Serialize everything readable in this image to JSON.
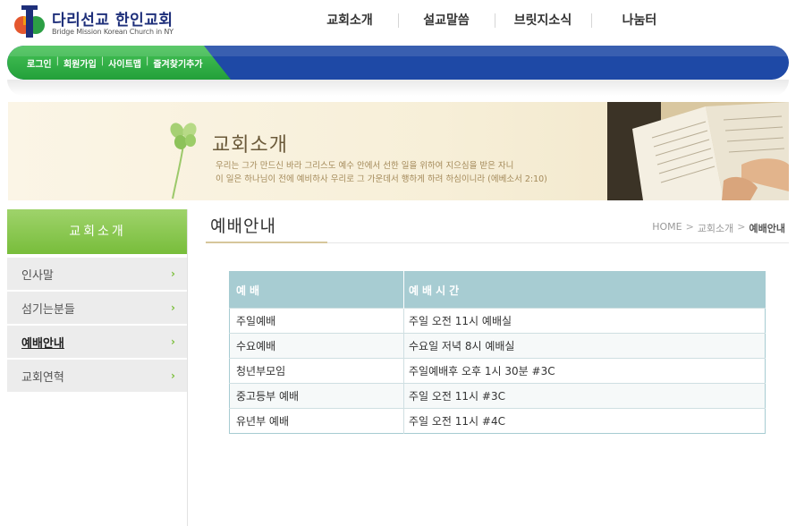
{
  "header": {
    "logo_title": "다리선교 한인교회",
    "logo_subtitle": "Bridge Mission Korean Church in NY",
    "nav": [
      "교회소개",
      "설교말씀",
      "브릿지소식",
      "나눔터"
    ]
  },
  "util_links": [
    "로그인",
    "회원가입",
    "사이트맵",
    "즐겨찾기추가"
  ],
  "banner": {
    "title": "교회소개",
    "verse_line1": "우리는 그가 만드신 바라 그리스도 예수 안에서 선한 일을 위하여 지으심을 받은 자니",
    "verse_line2": "이 일은 하나님이 전에 예비하사 우리로 그 가운데서 행하게 하려 하심이니라 (에베소서 2:10)"
  },
  "sidebar": {
    "title": "교회소개",
    "items": [
      {
        "label": "인사말",
        "arrow": "›"
      },
      {
        "label": "섬기는분들",
        "arrow": "›"
      },
      {
        "label": "예배안내",
        "arrow": "›"
      },
      {
        "label": "교회연혁",
        "arrow": "›"
      }
    ],
    "active_index": 2
  },
  "content": {
    "title": "예배안내",
    "breadcrumb": [
      "HOME",
      "교회소개",
      "예배안내"
    ],
    "breadcrumb_sep": ">",
    "table": {
      "headers": [
        "예배",
        "예배시간"
      ],
      "rows": [
        [
          "주일예배",
          "주일 오전 11시 예배실"
        ],
        [
          "수요예배",
          "수요일 저녁 8시 예배실"
        ],
        [
          "청년부모임",
          "주일예배후 오후 1시 30분  #3C"
        ],
        [
          "중고등부 예배",
          "주일 오전 11시  #3C"
        ],
        [
          "유년부 예배",
          "주일 오전 11시  #4C"
        ]
      ]
    }
  },
  "colors": {
    "brand_blue": "#1e49a6",
    "brand_green": "#23a03a",
    "sidebar_green": "#78bd3b",
    "table_header": "#a7ccd2"
  }
}
